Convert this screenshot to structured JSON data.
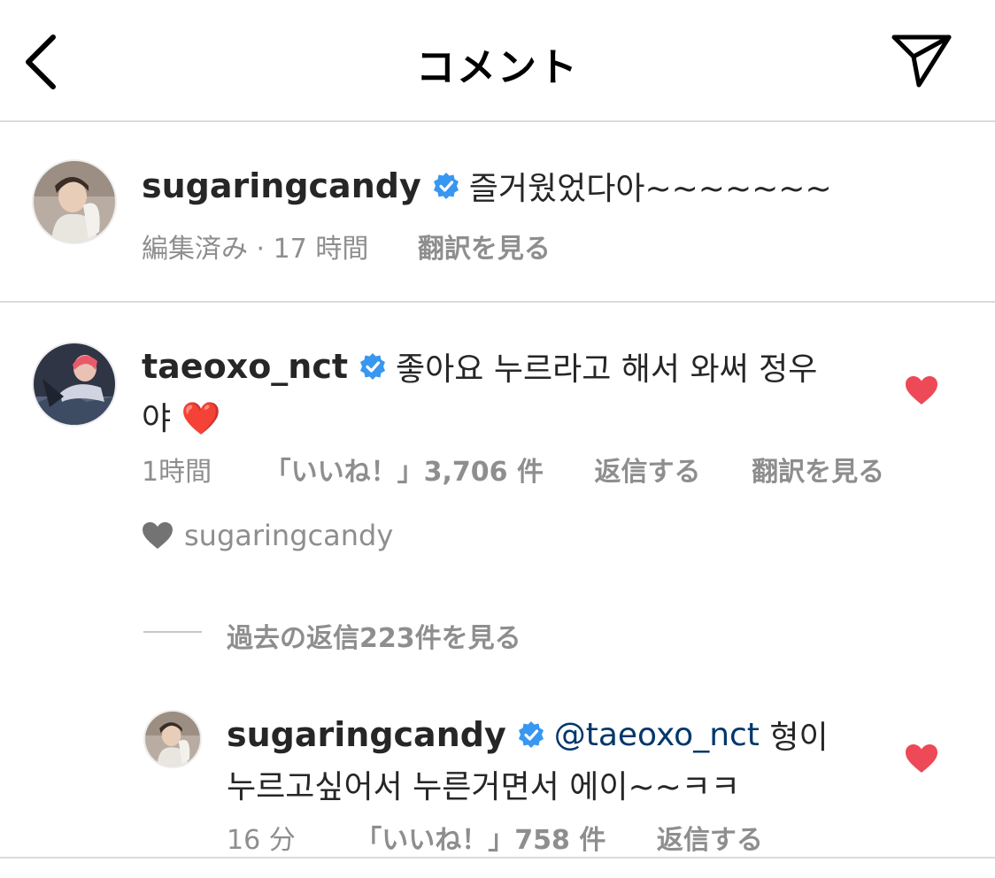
{
  "header": {
    "title": "コメント",
    "back_icon": "chevron-left-icon",
    "share_icon": "paper-plane-icon"
  },
  "caption": {
    "username": "sugaringcandy",
    "verified": true,
    "text": "즐거웠었다아~~~~~~~",
    "meta": "編集済み · 17 時間",
    "translate_label": "翻訳を見る"
  },
  "comment": {
    "username": "taeoxo_nct",
    "verified": true,
    "text_line1": "좋아요 누르라고 해서 와써 정우",
    "text_line2": "야 ❤️",
    "time": "1時間",
    "likes": "「いいね！」3,706 件",
    "reply_label": "返信する",
    "translate_label": "翻訳を見る",
    "liked": true,
    "liked_by_author": "sugaringcandy"
  },
  "view_replies_label": "過去の返信223件を見る",
  "reply": {
    "username": "sugaringcandy",
    "verified": true,
    "mention": "@taeoxo_nct",
    "text_line1_rest": " 형이",
    "text_line2": "누르고싶어서 누른거면서 에이~~ㅋㅋ",
    "time": "16 分",
    "likes": "「いいね！」758 件",
    "reply_label": "返信する",
    "liked": true
  },
  "colors": {
    "verified_blue": "#3897f0",
    "like_red": "#ed4956",
    "meta_gray": "#8e8e8e",
    "mention_blue": "#00376b",
    "divider": "#dbdbdb"
  }
}
